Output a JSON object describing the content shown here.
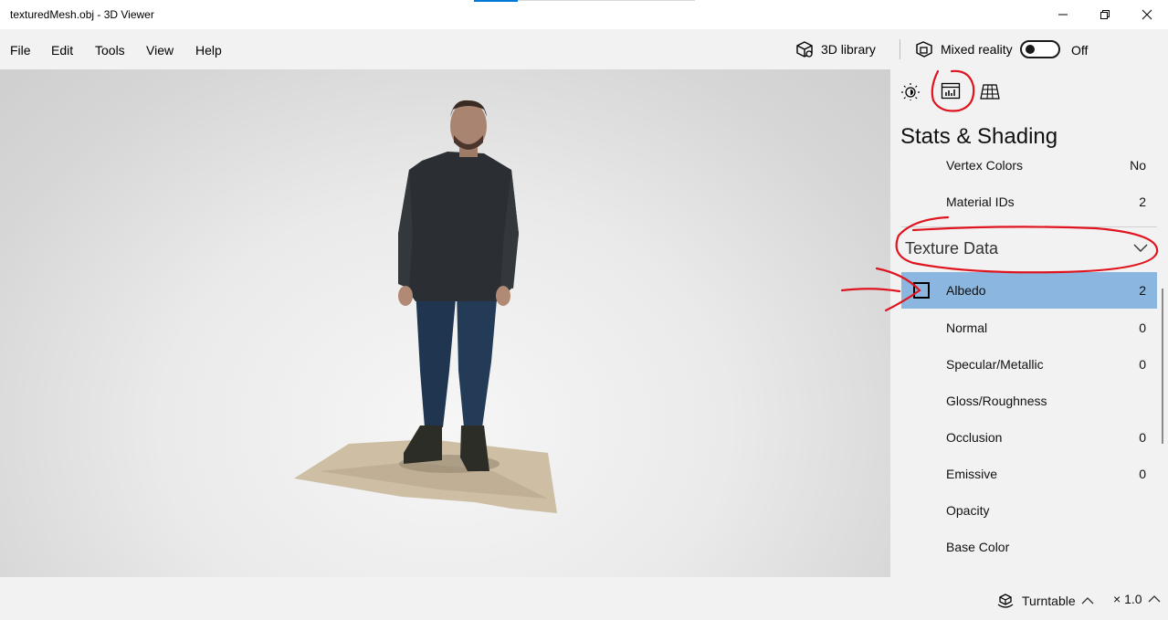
{
  "window": {
    "title": "texturedMesh.obj - 3D Viewer",
    "minimize_icon": "minimize-icon",
    "restore_icon": "restore-icon",
    "close_icon": "close-icon"
  },
  "menu": {
    "items": [
      "File",
      "Edit",
      "Tools",
      "View",
      "Help"
    ]
  },
  "toolbar": {
    "library_label": "3D library",
    "mixed_reality_label": "Mixed reality",
    "toggle_state": "Off"
  },
  "panel": {
    "tabs": [
      "lighting-icon",
      "stats-icon",
      "grid-icon"
    ],
    "title": "Stats & Shading",
    "stats_rows": [
      {
        "label": "Vertex Colors",
        "value": "No"
      },
      {
        "label": "Material IDs",
        "value": "2"
      }
    ],
    "section_title": "Texture Data",
    "texture_rows": [
      {
        "label": "Albedo",
        "value": "2"
      },
      {
        "label": "Normal",
        "value": "0"
      },
      {
        "label": "Specular/Metallic",
        "value": "0"
      },
      {
        "label": "Gloss/Roughness",
        "value": ""
      },
      {
        "label": "Occlusion",
        "value": "0"
      },
      {
        "label": "Emissive",
        "value": "0"
      },
      {
        "label": "Opacity",
        "value": ""
      },
      {
        "label": "Base Color",
        "value": ""
      }
    ]
  },
  "statusbar": {
    "animation_label": "Turntable",
    "speed_label": "× 1.0"
  },
  "colors": {
    "selected_row": "#8bb6df",
    "accent": "#0078d7",
    "annotation": "#e0141e"
  }
}
